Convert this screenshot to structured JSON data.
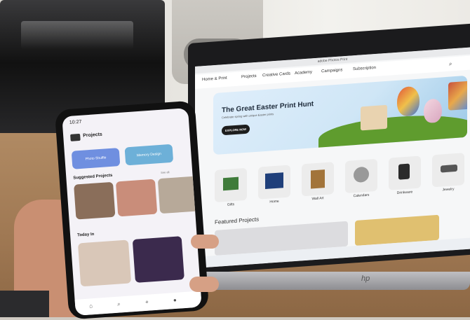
{
  "laptop": {
    "window_title": "adobe Photos Print",
    "nav": [
      "Home & Print",
      "Projects",
      "Creative Cards",
      "Academy",
      "Campaigns",
      "Subscription"
    ],
    "hero": {
      "title": "The Great Easter Print Hunt",
      "subtitle": "Celebrate spring with unique Easter prints",
      "button": "EXPLORE NOW"
    },
    "categories": [
      "Gifts",
      "Home",
      "Wall Art",
      "Calendars",
      "Drinkware",
      "Jewelry"
    ],
    "featured_title": "Featured Projects",
    "brand": "hp"
  },
  "phone": {
    "status_time": "10:27",
    "header_title": "Projects",
    "buttons": [
      "Photo Shuffle",
      "Memory Design"
    ],
    "section_1": "Suggested Projects",
    "section_1_link": "See all",
    "section_2": "Today In",
    "colors": {
      "btn1": "#6f8fe0",
      "btn2": "#6db0d8"
    }
  }
}
